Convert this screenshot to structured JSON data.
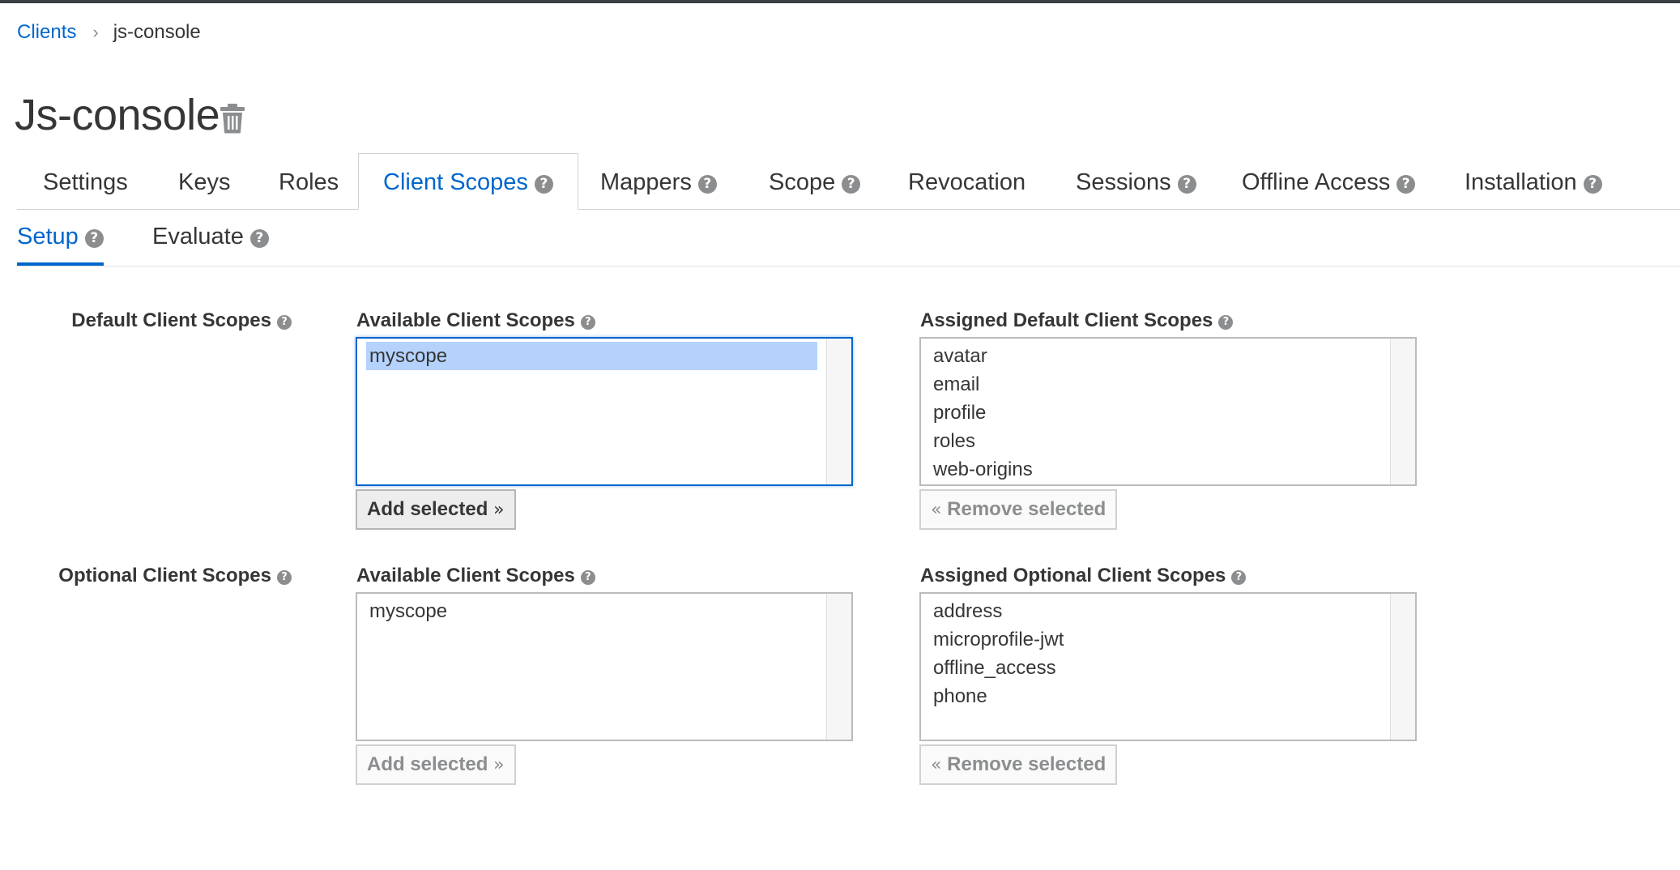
{
  "breadcrumb": {
    "parent": "Clients",
    "current": "js-console"
  },
  "page": {
    "title": "Js-console",
    "delete_icon": "trash-icon"
  },
  "tabs": [
    {
      "label": "Settings",
      "help": false
    },
    {
      "label": "Keys",
      "help": false
    },
    {
      "label": "Roles",
      "help": false
    },
    {
      "label": "Client Scopes",
      "help": true,
      "active": true
    },
    {
      "label": "Mappers",
      "help": true
    },
    {
      "label": "Scope",
      "help": true
    },
    {
      "label": "Revocation",
      "help": false
    },
    {
      "label": "Sessions",
      "help": true
    },
    {
      "label": "Offline Access",
      "help": true
    },
    {
      "label": "Installation",
      "help": true
    }
  ],
  "subtabs": [
    {
      "label": "Setup",
      "active": true
    },
    {
      "label": "Evaluate"
    }
  ],
  "help_glyph": "?",
  "default_scopes": {
    "row_label": "Default Client Scopes",
    "available_label": "Available Client Scopes",
    "available_items": [
      "myscope"
    ],
    "available_selected": "myscope",
    "assigned_label": "Assigned Default Client Scopes",
    "assigned_items": [
      "avatar",
      "email",
      "profile",
      "roles",
      "web-origins"
    ],
    "add_button": "Add selected",
    "remove_button": "Remove selected"
  },
  "optional_scopes": {
    "row_label": "Optional Client Scopes",
    "available_label": "Available Client Scopes",
    "available_items": [
      "myscope"
    ],
    "assigned_label": "Assigned Optional Client Scopes",
    "assigned_items": [
      "address",
      "microprofile-jwt",
      "offline_access",
      "phone"
    ],
    "add_button": "Add selected",
    "remove_button": "Remove selected"
  },
  "colors": {
    "accent": "#0066cc",
    "selection": "#b4d2fc",
    "text": "#363636",
    "muted": "#8b8d8f"
  }
}
